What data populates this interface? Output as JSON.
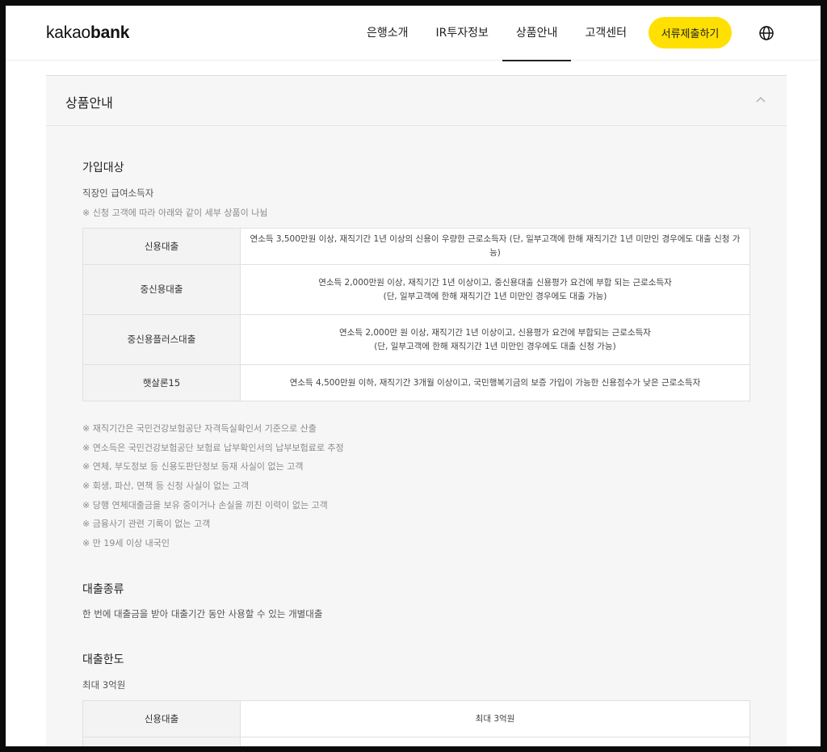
{
  "header": {
    "logo_light": "kakao",
    "logo_bold": "bank",
    "nav": [
      "은행소개",
      "IR투자정보",
      "상품안내",
      "고객센터"
    ],
    "active_nav": "상품안내",
    "cta_label": "서류제출하기",
    "globe_icon": "globe-icon"
  },
  "panel": {
    "title": "상품안내",
    "toggle_icon": "chevron-up-icon",
    "eligibility": {
      "title": "가입대상",
      "desc": "직장인 급여소득자",
      "note": "※ 신청 고객에 따라 아래와 같이 세부 상품이 나뉨",
      "rows": [
        {
          "product": "신용대출",
          "lines": [
            "연소득 3,500만원 이상, 재직기간 1년 이상의 신용이 우량한 근로소득자 (단, 일부고객에 한해 재직기간 1년 미만인 경우에도 대출 신청 가능)"
          ]
        },
        {
          "product": "중신용대출",
          "lines": [
            "연소득 2,000만원 이상, 재직기간 1년 이상이고, 중신용대출 신용평가 요건에 부합 되는 근로소득자",
            "(단, 일부고객에 한해 재직기간 1년 미만인 경우에도 대출 가능)"
          ]
        },
        {
          "product": "중신용플러스대출",
          "lines": [
            "연소득 2,000만 원 이상, 재직기간 1년 이상이고, 신용평가 요건에 부합되는 근로소득자",
            "(단, 일부고객에 한해 재직기간 1년 미만인 경우에도 대출 신청 가능)"
          ]
        },
        {
          "product": "햇살론15",
          "lines": [
            "연소득 4,500만원 이하, 재직기간 3개월 이상이고, 국민행복기금의 보증 가입이 가능한 신용점수가 낮은 근로소득자"
          ]
        }
      ],
      "notes": [
        "※ 재직기간은 국민건강보험공단 자격득실확인서 기준으로 산출",
        "※ 연소득은 국민건강보험공단 보험료 납부확인서의 납부보험료로 추정",
        "※ 연체, 부도정보 등 신용도판단정보 등재 사실이 없는 고객",
        "※ 회생, 파산, 면책 등 신청 사실이 없는 고객",
        "※ 당행 연체대출금을 보유 중이거나 손실을 끼친 이력이 없는 고객",
        "※ 금융사기 관련 기록이 없는 고객",
        "※ 만 19세 이상 내국인"
      ]
    },
    "loan_type": {
      "title": "대출종류",
      "desc": "한 번에 대출금을 받아 대출기간 동안 사용할 수 있는 개별대출"
    },
    "loan_limit": {
      "title": "대출한도",
      "desc": "최대 3억원",
      "rows": [
        {
          "product": "신용대출",
          "value": "최대 3억원"
        },
        {
          "product": "",
          "value": ""
        }
      ]
    }
  }
}
